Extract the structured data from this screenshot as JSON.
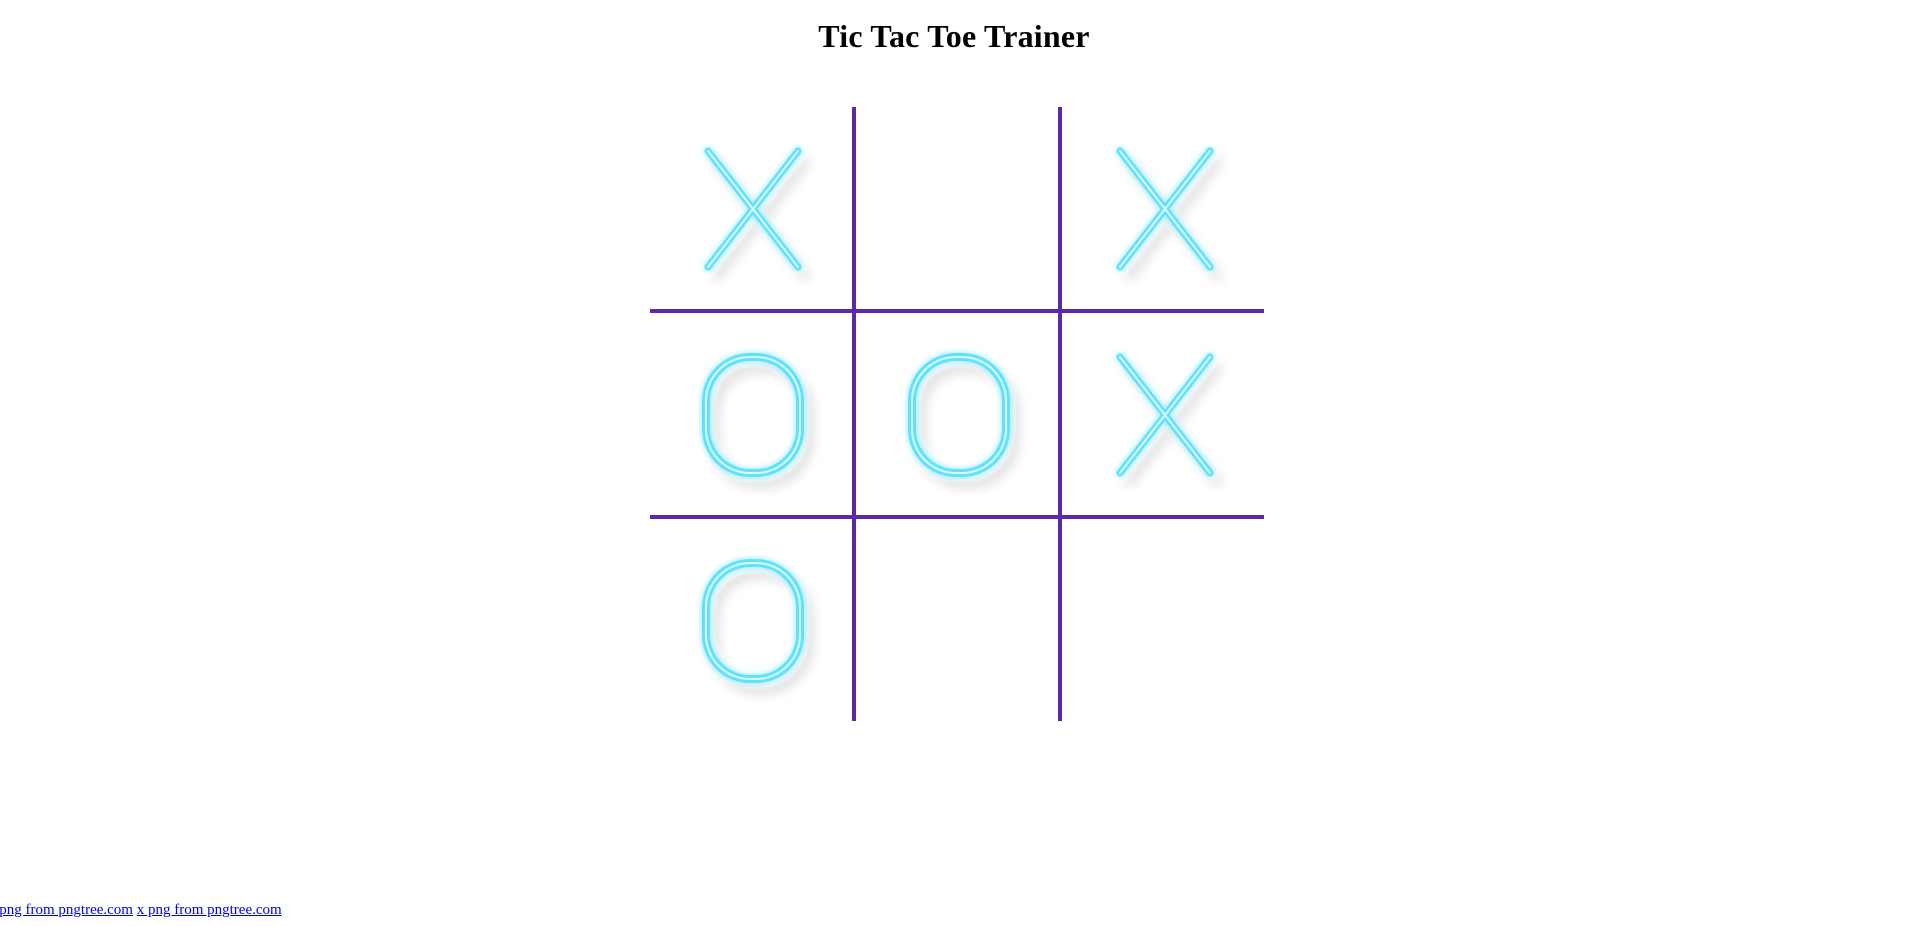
{
  "page": {
    "title": "Tic Tac Toe Trainer"
  },
  "board": {
    "line_color": "#5c2aa8",
    "mark_color": "#5fe3fb",
    "cells": [
      "X",
      "",
      "X",
      "O",
      "O",
      "X",
      "O",
      "",
      ""
    ]
  },
  "credits": {
    "links": [
      {
        "label": "o png from pngtree.com"
      },
      {
        "label": "x png from pngtree.com"
      }
    ]
  }
}
